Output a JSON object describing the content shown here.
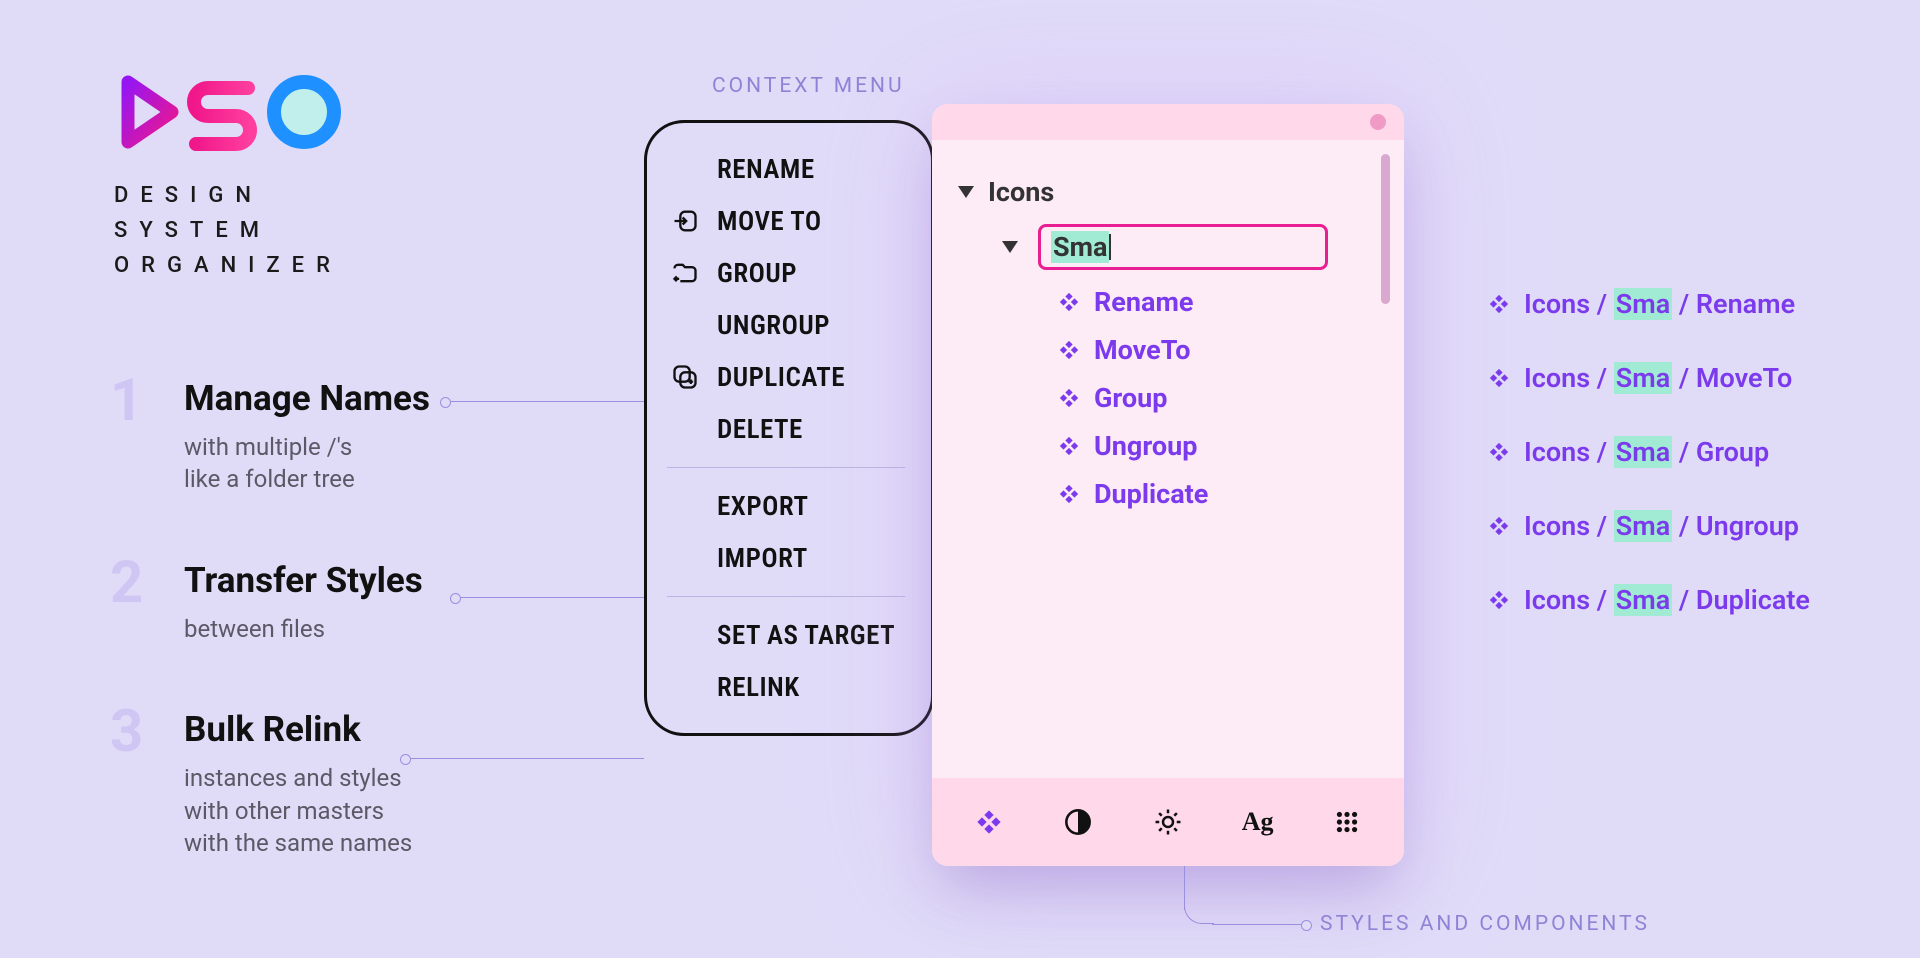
{
  "logo": {
    "line1": "DESIGN",
    "line2": "SYSTEM",
    "line3": "ORGANIZER"
  },
  "features": [
    {
      "num": "1",
      "title": "Manage Names",
      "desc": "with multiple /'s\nlike a folder tree"
    },
    {
      "num": "2",
      "title": "Transfer Styles",
      "desc": "between files"
    },
    {
      "num": "3",
      "title": "Bulk Relink",
      "desc": "instances and styles\nwith other masters\nwith the same names"
    }
  ],
  "labels": {
    "context_menu": "CONTEXT MENU",
    "styles": "STYLES AND COMPONENTS"
  },
  "context_menu": [
    {
      "label": "RENAME"
    },
    {
      "label": "MOVE TO"
    },
    {
      "label": "GROUP"
    },
    {
      "label": "UNGROUP"
    },
    {
      "label": "DUPLICATE"
    },
    {
      "label": "DELETE"
    },
    {
      "label": "EXPORT"
    },
    {
      "label": "IMPORT"
    },
    {
      "label": "SET AS TARGET"
    },
    {
      "label": "RELINK"
    }
  ],
  "panel": {
    "root": "Icons",
    "editing": "Sma",
    "children": [
      "Rename",
      "MoveTo",
      "Group",
      "Ungroup",
      "Duplicate"
    ]
  },
  "paths_prefix": "Icons",
  "paths_mid": "Sma",
  "paths": [
    "Rename",
    "MoveTo",
    "Group",
    "Ungroup",
    "Duplicate"
  ],
  "tabs": {
    "text": "Ag"
  }
}
